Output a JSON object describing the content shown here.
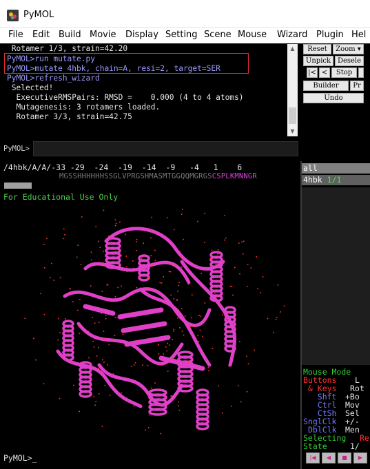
{
  "window": {
    "title": "PyMOL"
  },
  "menu": [
    "File",
    "Edit",
    "Build",
    "Movie",
    "Display",
    "Setting",
    "Scene",
    "Mouse",
    "Wizard",
    "Plugin",
    "Hel"
  ],
  "console": {
    "lines": [
      {
        "text": " Rotamer 1/3, strain=42.20",
        "kind": "white"
      },
      {
        "text": "PyMOL>run mutate.py",
        "kind": "cmd"
      },
      {
        "text": "PyMOL>mutate 4hbk, chain=A, resi=2, target=SER",
        "kind": "cmd"
      },
      {
        "text": "PyMOL>refresh_wizard",
        "kind": "cmd"
      },
      {
        "text": " Selected!",
        "kind": "white"
      },
      {
        "text": "  ExecutiveRMSPairs: RMSD =    0.000 (4 to 4 atoms)",
        "kind": "white"
      },
      {
        "text": "  Mutagenesis: 3 rotamers loaded.",
        "kind": "white"
      },
      {
        "text": "  Rotamer 3/3, strain=42.75",
        "kind": "white"
      }
    ]
  },
  "command": {
    "label": "PyMOL>",
    "value": ""
  },
  "buttons": {
    "reset": "Reset",
    "zoom": "Zoom ▾",
    "unpick": "Unpick",
    "deselect": "Desele",
    "rewind": "|<",
    "back": "<",
    "stop": "Stop",
    "builder": "Builder",
    "properties": "Pr",
    "undo": "Undo"
  },
  "sequence": {
    "numbers": "/4hbk/A/A/-33 -29  -24  -19  -14  -9   -4   1    6",
    "residues": "MGSSHHHHHHSSGLVPRGSHMASMTGGQQMGRGS",
    "residues_hl": "CSPLKMNNGR"
  },
  "objects": [
    {
      "name": "all",
      "state": ""
    },
    {
      "name": "4hbk",
      "state": "1/1"
    }
  ],
  "viewport": {
    "watermark": "For Educational Use Only"
  },
  "mouse_mode": {
    "title": "Mouse Mode",
    "rows": [
      {
        "a": "Buttons",
        "b": "L",
        "ac": "red",
        "bc": "white"
      },
      {
        "a": " & Keys",
        "b": "Rot",
        "ac": "red",
        "bc": "white"
      },
      {
        "a": "   Shft",
        "b": "+Bo",
        "ac": "blue",
        "bc": "white"
      },
      {
        "a": "   Ctrl",
        "b": "Mov",
        "ac": "blue",
        "bc": "white"
      },
      {
        "a": "   CtSh",
        "b": "Sel",
        "ac": "blue",
        "bc": "white"
      },
      {
        "a": "SnglClk",
        "b": "+/-",
        "ac": "blue",
        "bc": "white"
      },
      {
        "a": "DblClk",
        "b": "Men",
        "ac": "blue",
        "bc": "white"
      },
      {
        "a": "Selecting",
        "b": "Re",
        "ac": "green",
        "bc": "red"
      },
      {
        "a": "State",
        "b": "1/",
        "ac": "green",
        "bc": "white"
      }
    ]
  },
  "bottom_command": "PyMOL>_",
  "colors": {
    "protein": "#e040c8",
    "waters": "#ff3a2a",
    "background": "#000000",
    "console_cmd": "#9b9bff"
  }
}
